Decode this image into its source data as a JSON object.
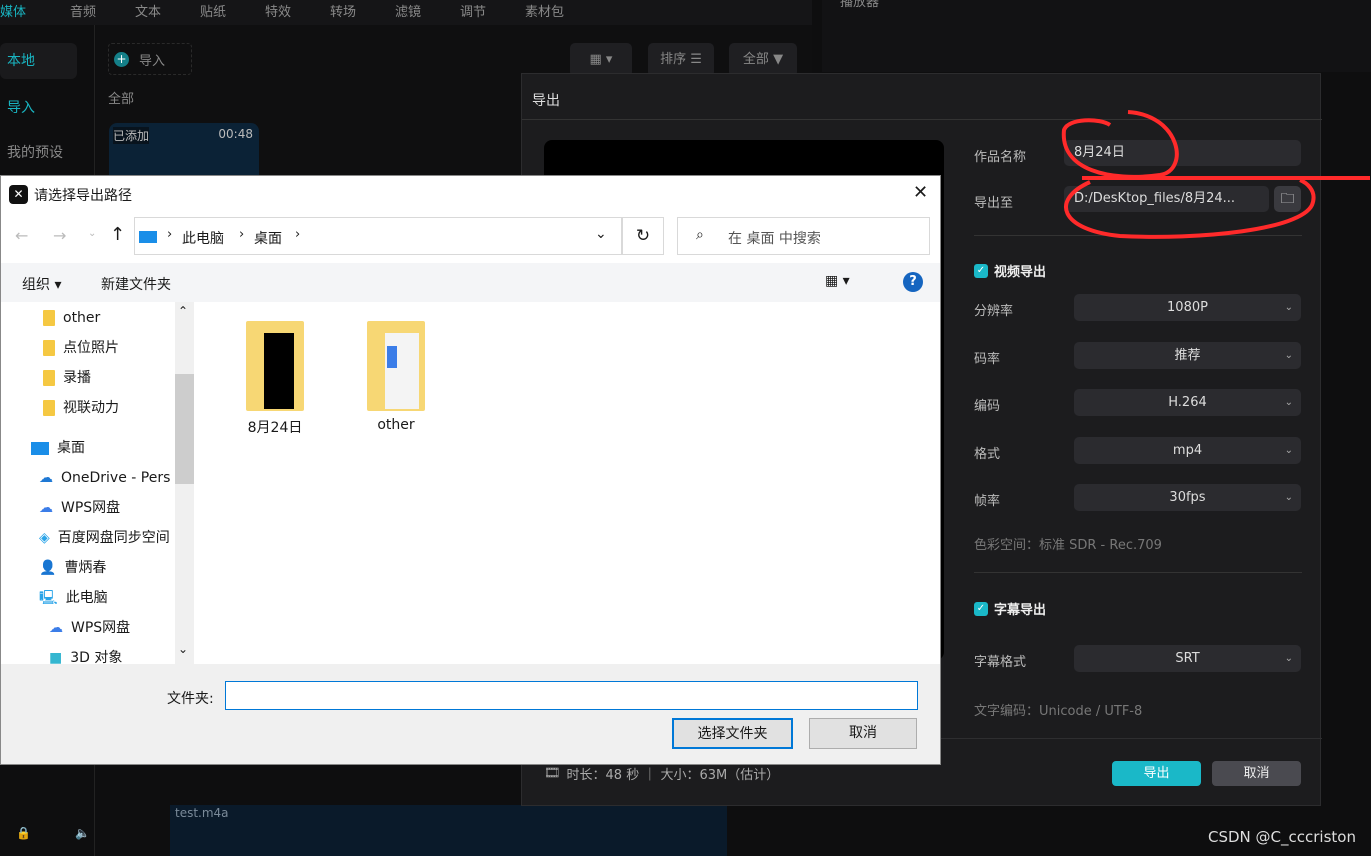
{
  "top_menu": [
    "媒体",
    "音频",
    "文本",
    "贴纸",
    "特效",
    "转场",
    "滤镜",
    "调节",
    "素材包"
  ],
  "top_right_title": "播放器",
  "sidebar": [
    "本地",
    "导入",
    "我的预设"
  ],
  "media": {
    "import_label": "导入",
    "filter_all": "全部",
    "sort_label": "排序",
    "all_label": "全部",
    "clip": {
      "badge": "已添加",
      "duration": "00:48"
    }
  },
  "timeline": {
    "track_name": "test.m4a"
  },
  "export_dialog": {
    "title": "导出",
    "name_label": "作品名称",
    "name_value": "8月24日",
    "path_label": "导出至",
    "path_value": "D:/DesKtop_files/8月24...",
    "video_section": "视频导出",
    "video_checked": true,
    "settings": [
      {
        "label": "分辨率",
        "value": "1080P"
      },
      {
        "label": "码率",
        "value": "推荐"
      },
      {
        "label": "编码",
        "value": "H.264"
      },
      {
        "label": "格式",
        "value": "mp4"
      },
      {
        "label": "帧率",
        "value": "30fps"
      }
    ],
    "color_space": "色彩空间：标准 SDR - Rec.709",
    "subtitle_section": "字幕导出",
    "subtitle_checked": true,
    "subtitle_format_label": "字幕格式",
    "subtitle_format_value": "SRT",
    "text_encoding": "文字编码：Unicode / UTF-8",
    "info": "时长：48 秒 ｜ 大小：63M（估计）",
    "export_button": "导出",
    "cancel_button": "取消",
    "accent": "#1ab8c8"
  },
  "file_dialog": {
    "title": "请选择导出路径",
    "breadcrumb": [
      "此电脑",
      "桌面"
    ],
    "search_placeholder": "在 桌面 中搜索",
    "organize": "组织",
    "new_folder": "新建文件夹",
    "tree": [
      "other",
      "点位照片",
      "录播",
      "视联动力",
      "桌面",
      "OneDrive - Pers",
      "WPS网盘",
      "百度网盘同步空间",
      "曹炳春",
      "此电脑",
      "WPS网盘",
      "3D 对象"
    ],
    "files": [
      "8月24日",
      "other"
    ],
    "folder_label": "文件夹:",
    "folder_value": "",
    "select_button": "选择文件夹",
    "cancel_button": "取消"
  },
  "watermark": "CSDN @C_cccriston",
  "annotation_color": "#ff2a2a"
}
